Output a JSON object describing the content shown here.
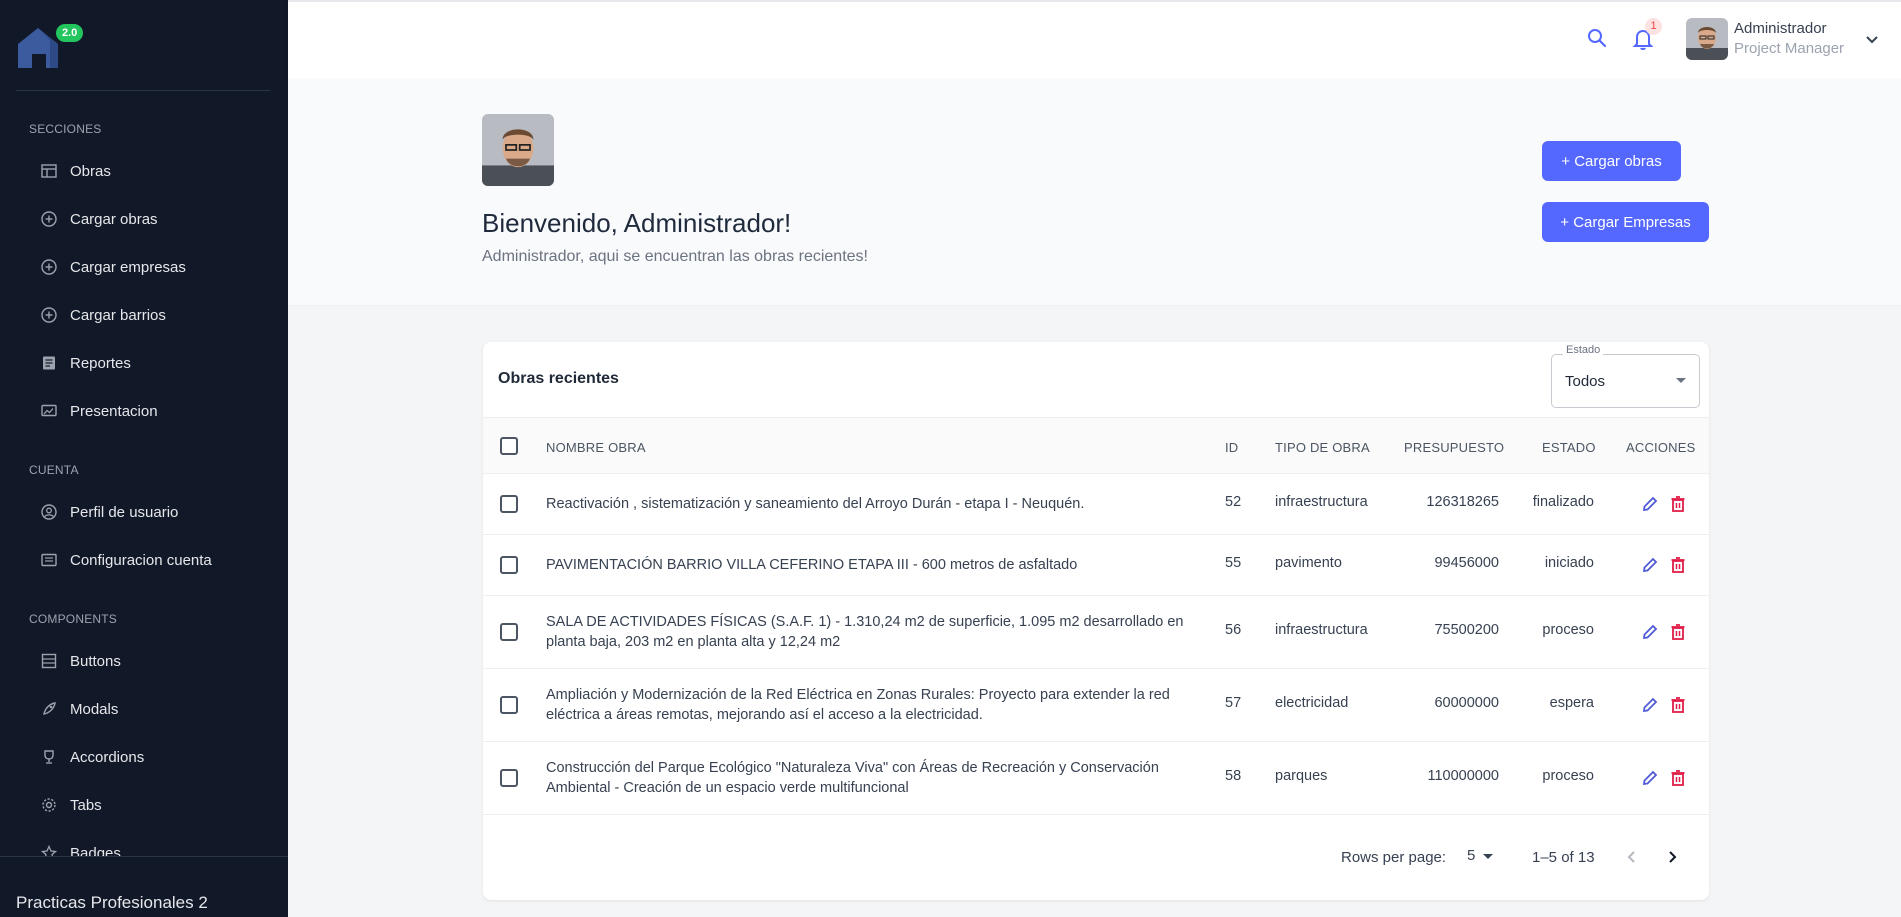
{
  "app": {
    "logo_badge": "2.0",
    "footer_title": "Practicas Profesionales 2"
  },
  "sidebar": {
    "sections": [
      {
        "title": "SECCIONES",
        "items": [
          {
            "label": "Obras",
            "icon": "table-icon"
          },
          {
            "label": "Cargar obras",
            "icon": "plus-circle-icon"
          },
          {
            "label": "Cargar empresas",
            "icon": "plus-circle-icon"
          },
          {
            "label": "Cargar barrios",
            "icon": "plus-circle-icon"
          },
          {
            "label": "Reportes",
            "icon": "document-icon"
          },
          {
            "label": "Presentacion",
            "icon": "presentation-icon"
          }
        ]
      },
      {
        "title": "CUENTA",
        "items": [
          {
            "label": "Perfil de usuario",
            "icon": "user-circle-icon"
          },
          {
            "label": "Configuracion cuenta",
            "icon": "settings-list-icon"
          }
        ]
      },
      {
        "title": "COMPONENTS",
        "items": [
          {
            "label": "Buttons",
            "icon": "grid-icon"
          },
          {
            "label": "Modals",
            "icon": "rocket-icon"
          },
          {
            "label": "Accordions",
            "icon": "trophy-icon"
          },
          {
            "label": "Tabs",
            "icon": "gear-icon"
          },
          {
            "label": "Badges",
            "icon": "badge-icon"
          }
        ]
      }
    ]
  },
  "topbar": {
    "notification_count": "1",
    "user_name": "Administrador",
    "user_role": "Project Manager"
  },
  "welcome": {
    "title": "Bienvenido, Administrador!",
    "subtitle": "Administrador, aqui se encuentran las obras recientes!",
    "btn_cargar_obras": "+ Cargar obras",
    "btn_cargar_empresas": "+ Cargar Empresas"
  },
  "table": {
    "title": "Obras recientes",
    "filter_label": "Estado",
    "filter_value": "Todos",
    "columns": [
      "NOMBRE OBRA",
      "ID",
      "TIPO DE OBRA",
      "PRESUPUESTO",
      "ESTADO",
      "ACCIONES"
    ],
    "rows": [
      {
        "nombre": "Reactivación , sistematización y saneamiento del Arroyo Durán - etapa I - Neuquén.",
        "id": "52",
        "tipo": "infraestructura",
        "presupuesto": "126318265",
        "estado": "finalizado"
      },
      {
        "nombre": "PAVIMENTACIÓN BARRIO VILLA CEFERINO ETAPA III - 600 metros de asfaltado",
        "id": "55",
        "tipo": "pavimento",
        "presupuesto": "99456000",
        "estado": "iniciado"
      },
      {
        "nombre": "SALA DE ACTIVIDADES FÍSICAS (S.A.F. 1) - 1.310,24 m2 de superficie, 1.095 m2 desarrollado en planta baja, 203 m2 en planta alta y 12,24 m2",
        "id": "56",
        "tipo": "infraestructura",
        "presupuesto": "75500200",
        "estado": "proceso"
      },
      {
        "nombre": "Ampliación y Modernización de la Red Eléctrica en Zonas Rurales: Proyecto para extender la red eléctrica a áreas remotas, mejorando así el acceso a la electricidad.",
        "id": "57",
        "tipo": "electricidad",
        "presupuesto": "60000000",
        "estado": "espera"
      },
      {
        "nombre": "Construcción del Parque Ecológico \"Naturaleza Viva\" con Áreas de Recreación y Conservación Ambiental - Creación de un espacio verde multifuncional",
        "id": "58",
        "tipo": "parques",
        "presupuesto": "110000000",
        "estado": "proceso"
      }
    ],
    "pagination": {
      "rows_per_page_label": "Rows per page:",
      "rows_per_page": "5",
      "range": "1–5 of 13"
    }
  },
  "colors": {
    "primary": "#5468ff",
    "sidebar_bg": "#111827",
    "edit_icon": "#4f5bd5",
    "delete_icon": "#e11d48",
    "badge_green": "#22c55e"
  }
}
